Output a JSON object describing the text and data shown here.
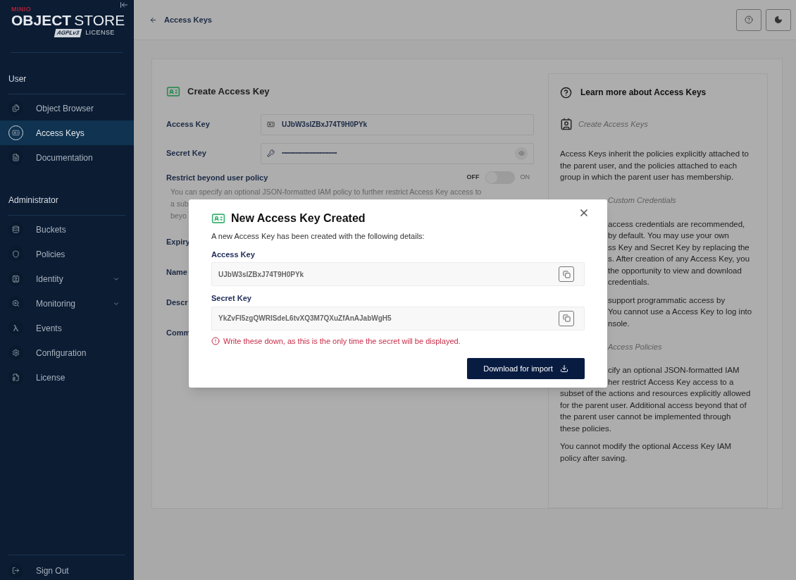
{
  "sidebar": {
    "logo": {
      "brand": "MINIO",
      "product_bold": "OBJECT",
      "product": "STORE",
      "badge": "AGPLv3",
      "license": "LICENSE"
    },
    "sections": [
      {
        "title": "User",
        "items": [
          {
            "label": "Object Browser",
            "selected": false,
            "expandable": false
          },
          {
            "label": "Access Keys",
            "selected": true,
            "expandable": false
          },
          {
            "label": "Documentation",
            "selected": false,
            "expandable": false
          }
        ]
      },
      {
        "title": "Administrator",
        "items": [
          {
            "label": "Buckets",
            "selected": false,
            "expandable": false
          },
          {
            "label": "Policies",
            "selected": false,
            "expandable": false
          },
          {
            "label": "Identity",
            "selected": false,
            "expandable": true
          },
          {
            "label": "Monitoring",
            "selected": false,
            "expandable": true
          },
          {
            "label": "Events",
            "selected": false,
            "expandable": false
          },
          {
            "label": "Configuration",
            "selected": false,
            "expandable": false
          },
          {
            "label": "License",
            "selected": false,
            "expandable": false
          }
        ]
      }
    ],
    "sign_out": "Sign Out"
  },
  "topbar": {
    "back_label": "Access Keys"
  },
  "form": {
    "title": "Create Access Key",
    "fields": [
      {
        "label": "Access Key",
        "value": "UJbW3sIZBxJ74T9H0PYk",
        "kind": "text"
      },
      {
        "label": "Secret Key",
        "value": "••••••••••••••••••••••••••••••••••••••••",
        "kind": "secret"
      }
    ],
    "restrict": {
      "label": "Restrict beyond user policy",
      "off_label": "OFF",
      "on_label": "ON",
      "on": false,
      "lines": [
        "You can specify an optional JSON-formatted IAM policy to further restrict Access Key access to",
        "a sub",
        "beyo"
      ]
    },
    "covered_labels": [
      "Expiry",
      "Name",
      "Descr",
      "Comm"
    ]
  },
  "help": {
    "title": "Learn more about Access Keys",
    "blocks": [
      {
        "kind": "heading",
        "text": "Create Access Keys",
        "covered": false
      },
      {
        "kind": "lines",
        "lines": [
          {
            "text": "Access Keys inherit the policies explicitly attached to",
            "covered": false
          },
          {
            "text": "the parent user, and the policies attached to each",
            "covered": false
          },
          {
            "text": "group in which the parent user has membership.",
            "covered": false
          }
        ]
      },
      {
        "kind": "heading",
        "text": "Custom Credentials",
        "covered": true
      },
      {
        "kind": "lines",
        "lines": [
          {
            "text": "access credentials are recommended,",
            "covered": true
          },
          {
            "text": "by default. You may use your own",
            "covered": true
          },
          {
            "text": "ss Key and Secret Key by replacing the",
            "covered": true
          },
          {
            "text": "s. After creation of any Access Key, you",
            "covered": true
          },
          {
            "text": "the opportunity to view and download",
            "covered": true
          },
          {
            "text": "credentials.",
            "covered": true
          }
        ]
      },
      {
        "kind": "lines",
        "lines": [
          {
            "text": "support programmatic access by",
            "covered": true
          },
          {
            "text": "You cannot use a Access Key to log into",
            "covered": true
          },
          {
            "text": "nsole.",
            "covered": true
          }
        ]
      },
      {
        "kind": "heading",
        "text": "Access Policies",
        "covered": true
      },
      {
        "kind": "lines",
        "lines": [
          {
            "text": "cify an optional JSON-formatted IAM",
            "covered": true
          },
          {
            "text": "her restrict Access Key access to a",
            "covered": true
          },
          {
            "text": "subset of the actions and resources explicitly allowed",
            "covered": false
          },
          {
            "text": "for the parent user. Additional access beyond that of",
            "covered": false
          },
          {
            "text": "the parent user cannot be implemented through",
            "covered": false
          },
          {
            "text": "these policies.",
            "covered": false
          }
        ]
      },
      {
        "kind": "lines",
        "lines": [
          {
            "text": "You cannot modify the optional Access Key IAM",
            "covered": false
          },
          {
            "text": "policy after saving.",
            "covered": false
          }
        ]
      }
    ]
  },
  "modal": {
    "title": "New Access Key Created",
    "description": "A new Access Key has been created with the following details:",
    "fields": [
      {
        "label": "Access Key",
        "value": "UJbW3sIZBxJ74T9H0PYk"
      },
      {
        "label": "Secret Key",
        "value": "YkZvFI5zgQWRISdeL6tvXQ3M7QXuZfAnAJabWgH5"
      }
    ],
    "warning": "Write these down, as this is the only time the secret will be displayed.",
    "download_label": "Download for import"
  }
}
